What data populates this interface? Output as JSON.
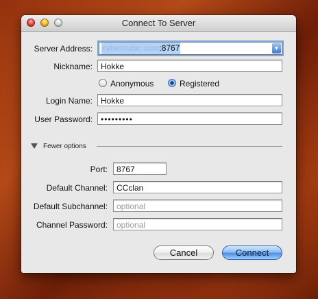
{
  "window": {
    "title": "Connect To Server"
  },
  "server": {
    "label": "Server Address:",
    "host_text": "cybercubic.com",
    "port_text": ":8767"
  },
  "nickname": {
    "label": "Nickname:",
    "value": "Hokke"
  },
  "auth": {
    "anonymous_label": "Anonymous",
    "registered_label": "Registered",
    "selected": "Registered"
  },
  "login": {
    "label": "Login Name:",
    "value": "Hokke"
  },
  "password": {
    "label": "User Password:",
    "value": "•••••••••"
  },
  "options_toggle": "Fewer options",
  "port": {
    "label": "Port:",
    "value": "8767"
  },
  "default_channel": {
    "label": "Default Channel:",
    "value": "CCclan"
  },
  "default_subchannel": {
    "label": "Default Subchannel:",
    "placeholder": "optional"
  },
  "channel_password": {
    "label": "Channel Password:",
    "placeholder": "optional"
  },
  "buttons": {
    "cancel": "Cancel",
    "connect": "Connect"
  },
  "colors": {
    "accent": "#4f8ee0",
    "desktop": "#8a2c0c"
  }
}
